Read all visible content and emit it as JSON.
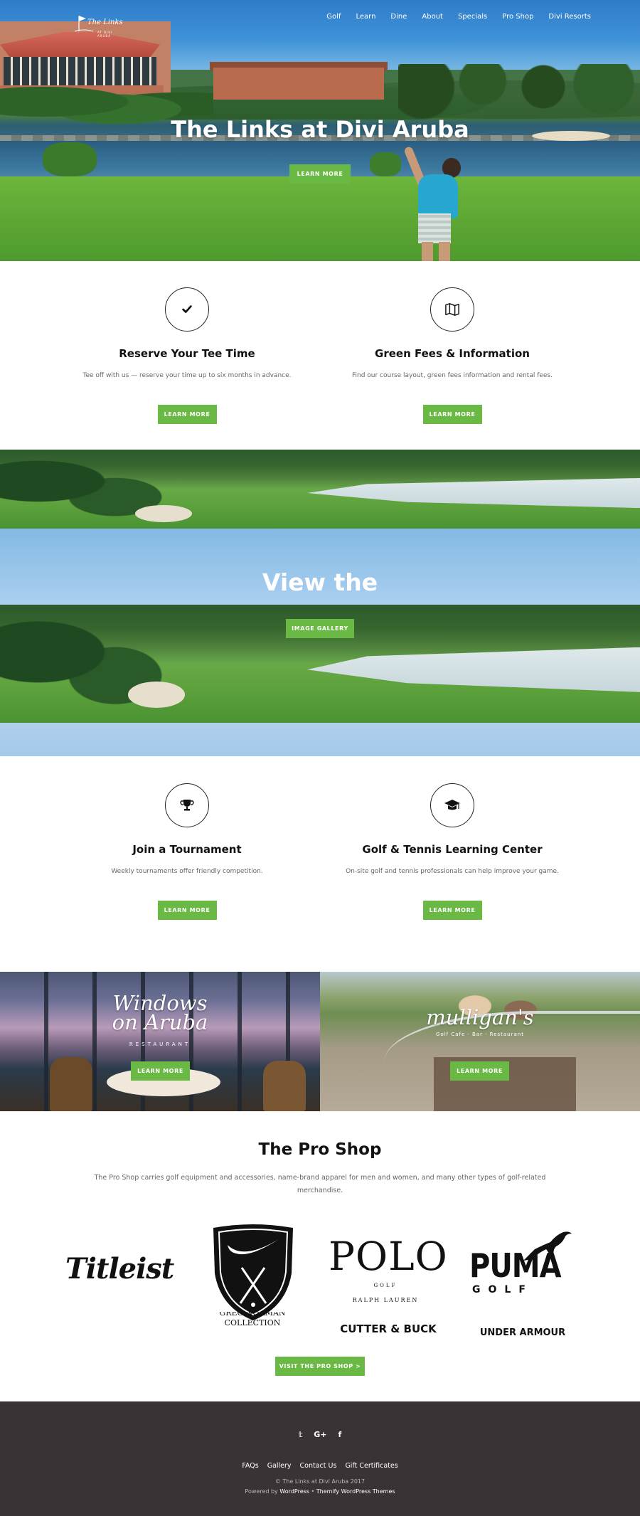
{
  "brand": {
    "logo_text": "The Links",
    "logo_sub": "AT DIVI ARUBA"
  },
  "nav": [
    {
      "label": "Golf"
    },
    {
      "label": "Learn"
    },
    {
      "label": "Dine"
    },
    {
      "label": "About"
    },
    {
      "label": "Specials"
    },
    {
      "label": "Pro Shop"
    },
    {
      "label": "Divi Resorts"
    }
  ],
  "hero": {
    "title": "The Links at Divi Aruba",
    "button": "Learn More"
  },
  "features_top": [
    {
      "icon": "check-icon",
      "title": "Reserve Your Tee Time",
      "text": "Tee off with us — reserve your time up to six months in advance.",
      "button": "Learn More"
    },
    {
      "icon": "map-icon",
      "title": "Green Fees & Information",
      "text": "Find our course layout, green fees information and rental fees.",
      "button": "Learn More"
    }
  ],
  "gallery": {
    "title": "View the",
    "button": "Image Gallery"
  },
  "features_bottom": [
    {
      "icon": "trophy-icon",
      "title": "Join a Tournament",
      "text": "Weekly tournaments offer friendly competition.",
      "button": "Learn More"
    },
    {
      "icon": "graduation-cap-icon",
      "title": "Golf & Tennis Learning Center",
      "text": "On-site golf and tennis professionals can help improve your game.",
      "button": "Learn More"
    }
  ],
  "restaurants": [
    {
      "name": "Windows on Aruba",
      "line1": "Windows",
      "line2": "on Aruba",
      "sub": "RESTAURANT",
      "button": "Learn More"
    },
    {
      "name": "mulligan's",
      "line1": "mulligan's",
      "sub": "Golf Cafe · Bar · Restaurant",
      "button": "Learn More"
    }
  ],
  "proshop": {
    "title": "The Pro Shop",
    "description": "The Pro Shop carries golf equipment and accessories, name-brand apparel for men and women, and many other types of golf-related merchandise.",
    "brands": {
      "titleist": "Titleist",
      "greg_norman_line1": "GREG NORMAN",
      "greg_norman_line2": "COLLECTION",
      "polo": "POLO",
      "polo_golf": "GOLF",
      "polo_rl": "RALPH LAUREN",
      "cutter": "CUTTER & BUCK",
      "puma": "PUMA",
      "puma_golf": "GOLF",
      "under_armour": "UNDER ARMOUR"
    },
    "button": "Visit the Pro Shop >"
  },
  "footer": {
    "social": [
      "twitter-icon",
      "google-plus-icon",
      "facebook-icon"
    ],
    "social_glyphs": [
      "𝕥",
      "G+",
      "f"
    ],
    "links": [
      "FAQs",
      "Gallery",
      "Contact Us",
      "Gift Certificates"
    ],
    "copyright": "© The Links at Divi Aruba 2017",
    "powered_prefix": "Powered by ",
    "powered_wp": "WordPress",
    "powered_sep": " • ",
    "powered_themify": "Themify WordPress Themes"
  },
  "colors": {
    "accent": "#6ab944",
    "footer_bg": "#3a3335"
  }
}
